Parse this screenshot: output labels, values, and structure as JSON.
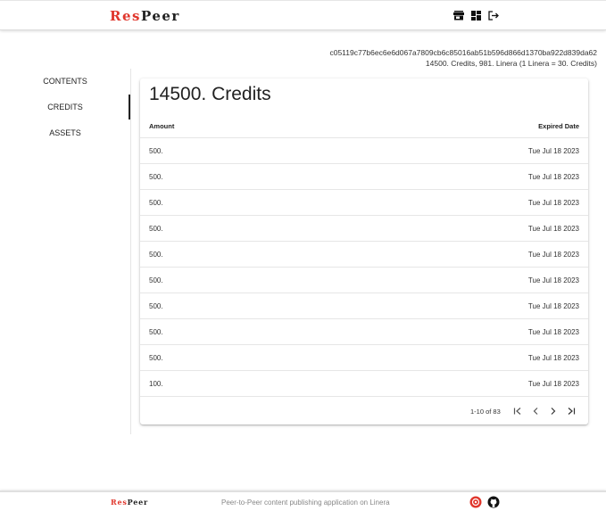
{
  "header": {
    "logo_part1": "Res",
    "logo_part2": "Peer",
    "icons": [
      "store-icon",
      "dashboard-icon",
      "logout-icon"
    ]
  },
  "account": {
    "address": "c05119c77b6ec6e6d067a7809cb6c85016ab51b596d866d1370ba922d839da62",
    "balance": "14500. Credits, 981. Linera (1 Linera = 30. Credits)"
  },
  "sidebar": {
    "items": [
      {
        "label": "CONTENTS",
        "active": false
      },
      {
        "label": "CREDITS",
        "active": true
      },
      {
        "label": "ASSETS",
        "active": false
      }
    ]
  },
  "credits": {
    "title": "14500. Credits",
    "columns": [
      "Amount",
      "Expired Date"
    ],
    "rows": [
      {
        "amount": "500.",
        "date": "Tue Jul 18 2023"
      },
      {
        "amount": "500.",
        "date": "Tue Jul 18 2023"
      },
      {
        "amount": "500.",
        "date": "Tue Jul 18 2023"
      },
      {
        "amount": "500.",
        "date": "Tue Jul 18 2023"
      },
      {
        "amount": "500.",
        "date": "Tue Jul 18 2023"
      },
      {
        "amount": "500.",
        "date": "Tue Jul 18 2023"
      },
      {
        "amount": "500.",
        "date": "Tue Jul 18 2023"
      },
      {
        "amount": "500.",
        "date": "Tue Jul 18 2023"
      },
      {
        "amount": "500.",
        "date": "Tue Jul 18 2023"
      },
      {
        "amount": "100.",
        "date": "Tue Jul 18 2023"
      }
    ],
    "pagination": {
      "range": "1-10 of 83"
    }
  },
  "footer": {
    "logo_part1": "Res",
    "logo_part2": "Peer",
    "text": "Peer-to-Peer content publishing application on Linera",
    "icons": [
      "linera-icon",
      "github-icon"
    ]
  },
  "colors": {
    "accent": "#e0362c"
  }
}
